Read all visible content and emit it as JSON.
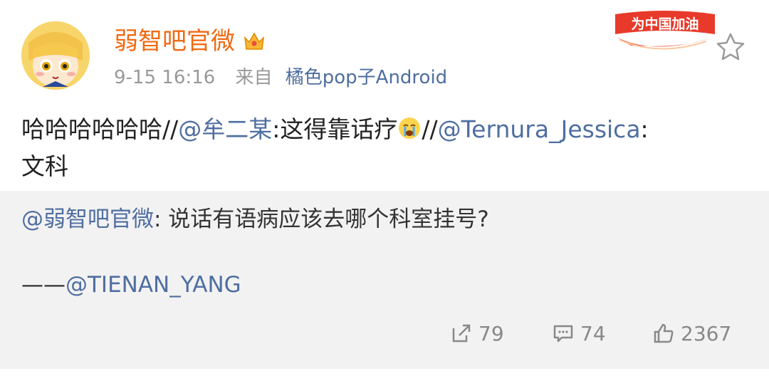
{
  "post": {
    "author": "弱智吧官微",
    "time": "9-15 16:16",
    "source_label": "来自",
    "source_name": "橘色pop子Android",
    "badge_text": "为中国加油",
    "text": {
      "part1": "哈哈哈哈哈哈//",
      "mention1": "@牟二某",
      "part2": ":这得靠话疗",
      "part3": "//",
      "mention2": "@Ternura_Jessica",
      "part4": ":",
      "line2": "文科"
    }
  },
  "quote": {
    "author_mention": "@弱智吧官微",
    "text": ": 说话有语病应该去哪个科室挂号?",
    "credit_dash": "——",
    "credit_mention": "@TIENAN_YANG",
    "actions": {
      "repost_count": "79",
      "comment_count": "74",
      "like_count": "2367"
    }
  },
  "colors": {
    "author_name": "#f06a12",
    "link": "#4f6ea0",
    "quote_bg": "#f2f2f2"
  },
  "icons": [
    "avatar",
    "crown-icon",
    "badge",
    "star-icon",
    "crying-emoji-icon",
    "repost-icon",
    "comment-icon",
    "like-icon"
  ]
}
